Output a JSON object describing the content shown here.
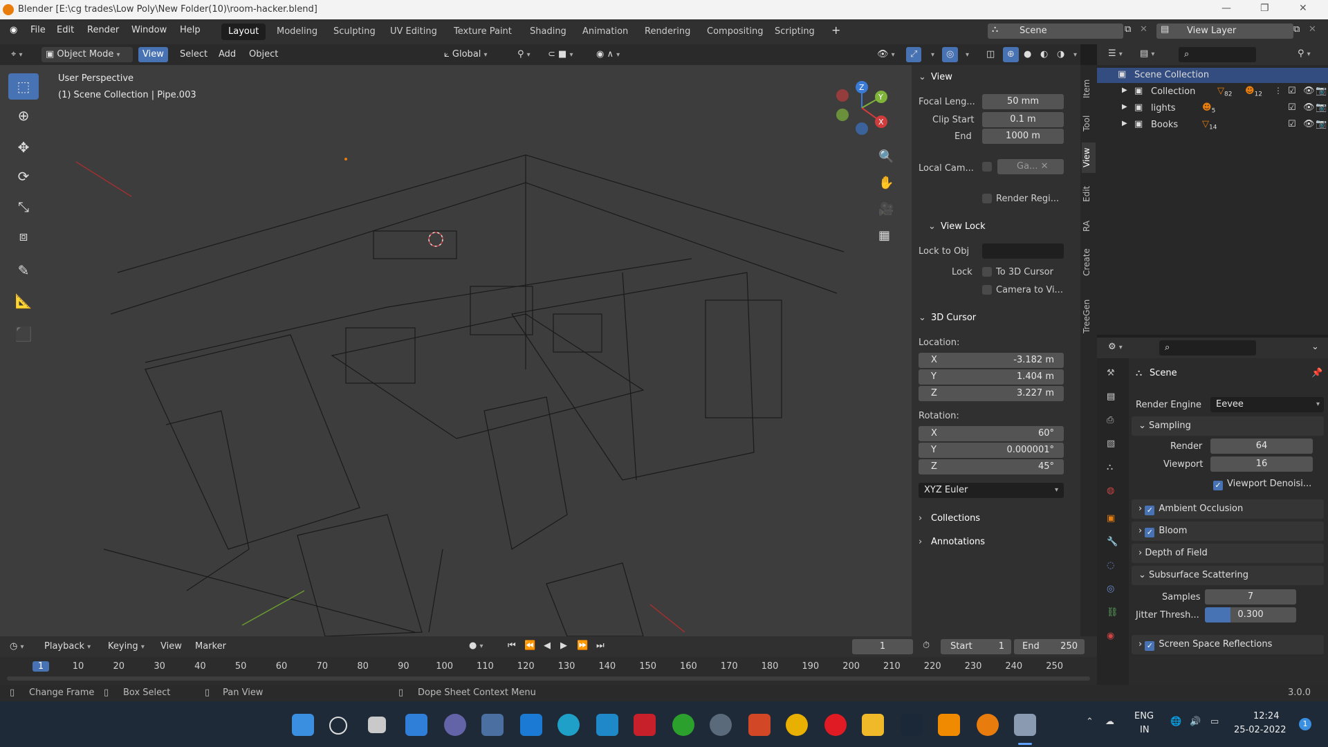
{
  "window": {
    "title": "Blender [E:\\cg trades\\Low Poly\\New Folder(10)\\room-hacker.blend]"
  },
  "menu": [
    "File",
    "Edit",
    "Render",
    "Window",
    "Help"
  ],
  "workspaces": [
    "Layout",
    "Modeling",
    "Sculpting",
    "UV Editing",
    "Texture Paint",
    "Shading",
    "Animation",
    "Rendering",
    "Compositing",
    "Scripting"
  ],
  "scene_name": "Scene",
  "view_layer": "View Layer",
  "header": {
    "mode": "Object Mode",
    "view": "View",
    "select": "Select",
    "add": "Add",
    "object": "Object",
    "orientation": "Global"
  },
  "viewport": {
    "perspective": "User Perspective",
    "context": "(1) Scene Collection | Pipe.003"
  },
  "gizmo": {
    "x": "X",
    "y": "Y",
    "z": "Z"
  },
  "npanel": {
    "view_title": "View",
    "focal_label": "Focal Leng...",
    "focal_value": "50 mm",
    "clip_start_label": "Clip Start",
    "clip_start_value": "0.1 m",
    "clip_end_label": "End",
    "clip_end_value": "1000 m",
    "local_cam_label": "Local Cam...",
    "local_cam_value": "Ga...",
    "render_region": "Render Regi...",
    "view_lock_title": "View Lock",
    "lock_obj_label": "Lock to Obj",
    "lock_label": "Lock",
    "to_cursor": "To 3D Cursor",
    "camera_to_view": "Camera to Vi...",
    "cursor_title": "3D Cursor",
    "location_label": "Location:",
    "loc_x": "-3.182 m",
    "loc_y": "1.404 m",
    "loc_z": "3.227 m",
    "rotation_label": "Rotation:",
    "rot_x": "60°",
    "rot_y": "0.000001°",
    "rot_z": "45°",
    "rot_mode": "XYZ Euler",
    "collections": "Collections",
    "annotations": "Annotations",
    "axis_x": "X",
    "axis_y": "Y",
    "axis_z": "Z"
  },
  "side_tabs": [
    "Item",
    "Tool",
    "View",
    "Edit",
    "RA",
    "Create",
    "TreeGen"
  ],
  "outliner": {
    "root": "Scene Collection",
    "items": [
      {
        "name": "Collection",
        "badge1": "82",
        "badge2": "12"
      },
      {
        "name": "lights",
        "badge1": "5"
      },
      {
        "name": "Books",
        "badge1": "14"
      }
    ]
  },
  "properties": {
    "scene": "Scene",
    "render_engine_label": "Render Engine",
    "render_engine": "Eevee",
    "sampling": "Sampling",
    "render_label": "Render",
    "render_value": "64",
    "viewport_label": "Viewport",
    "viewport_value": "16",
    "viewport_denoise": "Viewport Denoisi...",
    "ambient_occlusion": "Ambient Occlusion",
    "bloom": "Bloom",
    "depth_of_field": "Depth of Field",
    "sss": "Subsurface Scattering",
    "samples_label": "Samples",
    "samples_value": "7",
    "jitter_label": "Jitter Thresh...",
    "jitter_value": "0.300",
    "ssr": "Screen Space Reflections"
  },
  "timeline": {
    "playback": "Playback",
    "keying": "Keying",
    "view": "View",
    "marker": "Marker",
    "current_frame": "1",
    "start_label": "Start",
    "start": "1",
    "end_label": "End",
    "end": "250",
    "ticks": [
      "1",
      "10",
      "20",
      "30",
      "40",
      "50",
      "60",
      "70",
      "80",
      "90",
      "100",
      "110",
      "120",
      "130",
      "140",
      "150",
      "160",
      "170",
      "180",
      "190",
      "200",
      "210",
      "220",
      "230",
      "240",
      "250"
    ]
  },
  "status": {
    "change_frame": "Change Frame",
    "box_select": "Box Select",
    "pan_view": "Pan View",
    "context_menu": "Dope Sheet Context Menu",
    "version": "3.0.0"
  },
  "taskbar": {
    "lang": "ENG",
    "region": "IN",
    "time": "12:24",
    "date": "25-02-2022",
    "notif": "1"
  },
  "colors": {
    "accent": "#4772b3",
    "orange": "#e87d0d",
    "bg": "#303030"
  }
}
